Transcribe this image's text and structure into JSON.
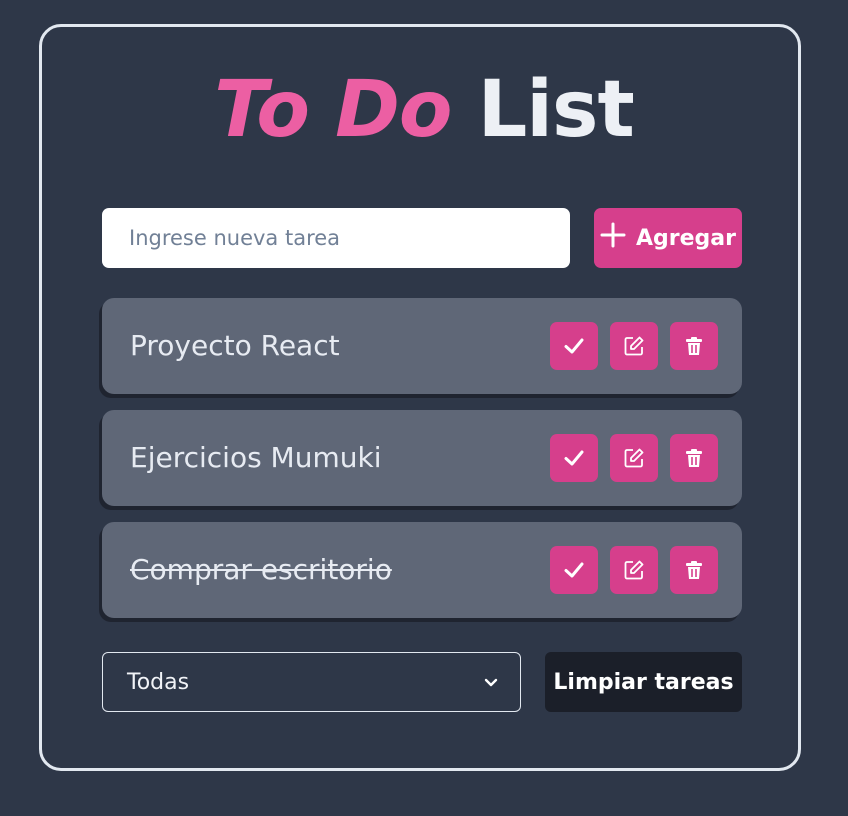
{
  "title": {
    "part1": "To Do",
    "part2": "List"
  },
  "new_task": {
    "placeholder": "Ingrese nueva tarea",
    "add_label": "Agregar"
  },
  "tasks": [
    {
      "text": "Proyecto React",
      "completed": false
    },
    {
      "text": "Ejercicios Mumuki",
      "completed": false
    },
    {
      "text": "Comprar escritorio",
      "completed": true
    }
  ],
  "filter": {
    "selected": "Todas"
  },
  "clear_label": "Limpiar tareas",
  "icons": {
    "add": "plus-icon",
    "complete": "check-icon",
    "edit": "edit-icon",
    "delete": "trash-icon",
    "dropdown": "chevron-down-icon"
  },
  "colors": {
    "accent": "#d63f8c",
    "title_accent": "#ec5fa3",
    "background": "#2e3748",
    "task_bg": "#5f6777"
  }
}
